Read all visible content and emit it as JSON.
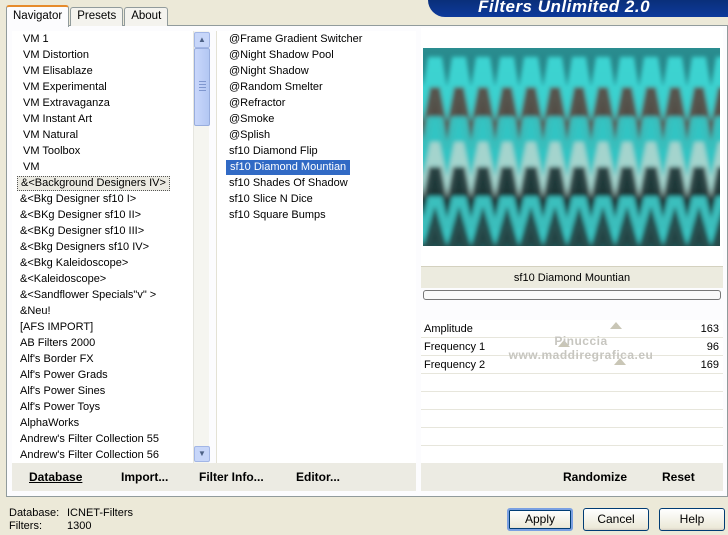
{
  "app": {
    "banner": "Filters Unlimited 2.0"
  },
  "tabs": [
    "Navigator",
    "Presets",
    "About"
  ],
  "categories": [
    "VM 1",
    "VM Distortion",
    "VM Elisablaze",
    "VM Experimental",
    "VM Extravaganza",
    "VM Instant Art",
    "VM Natural",
    "VM Toolbox",
    "VM",
    "&<Background Designers IV>",
    "&<Bkg Designer sf10 I>",
    "&<BKg Designer sf10 II>",
    "&<BKg Designer sf10 III>",
    "&<Bkg Designers sf10 IV>",
    "&<Bkg Kaleidoscope>",
    "&<Kaleidoscope>",
    "&<Sandflower Specials\"v\" >",
    "&Neu!",
    "[AFS IMPORT]",
    "AB Filters 2000",
    "Alf's Border FX",
    "Alf's Power Grads",
    "Alf's Power Sines",
    "Alf's Power Toys",
    "AlphaWorks",
    "Andrew's Filter Collection 55",
    "Andrew's Filter Collection 56"
  ],
  "filters": [
    "@Frame Gradient Switcher",
    "@Night Shadow Pool",
    "@Night Shadow",
    "@Random Smelter",
    "@Refractor",
    "@Smoke",
    "@Splish",
    "sf10 Diamond Flip",
    "sf10 Diamond Mountian",
    "sf10 Shades Of Shadow",
    "sf10 Slice N Dice",
    "sf10 Square Bumps"
  ],
  "selected_category": "&<Background Designers IV>",
  "selected_filter": "sf10 Diamond Mountian",
  "preview": {
    "filter_name": "sf10 Diamond Mountian"
  },
  "params": [
    {
      "label": "Amplitude",
      "value": "163",
      "fraction": 0.64
    },
    {
      "label": "Frequency 1",
      "value": "96",
      "fraction": 0.38
    },
    {
      "label": "Frequency 2",
      "value": "169",
      "fraction": 0.66
    }
  ],
  "watermark": {
    "line1": "Pinuccia",
    "line2": "www.maddiregrafica.eu"
  },
  "left_buttons": {
    "database": "Database",
    "import": "Import...",
    "filter_info": "Filter Info...",
    "editor": "Editor..."
  },
  "right_buttons": {
    "randomize": "Randomize",
    "reset": "Reset"
  },
  "footer": {
    "database_label": "Database:",
    "database_value": "ICNET-Filters",
    "filters_label": "Filters:",
    "filters_value": "1300"
  },
  "dialog_buttons": {
    "apply": "Apply",
    "cancel": "Cancel",
    "help": "Help"
  },
  "colors": {
    "accent": "#316ac5",
    "teal": "#1ea9ac",
    "dark": "#1e2a2c"
  }
}
